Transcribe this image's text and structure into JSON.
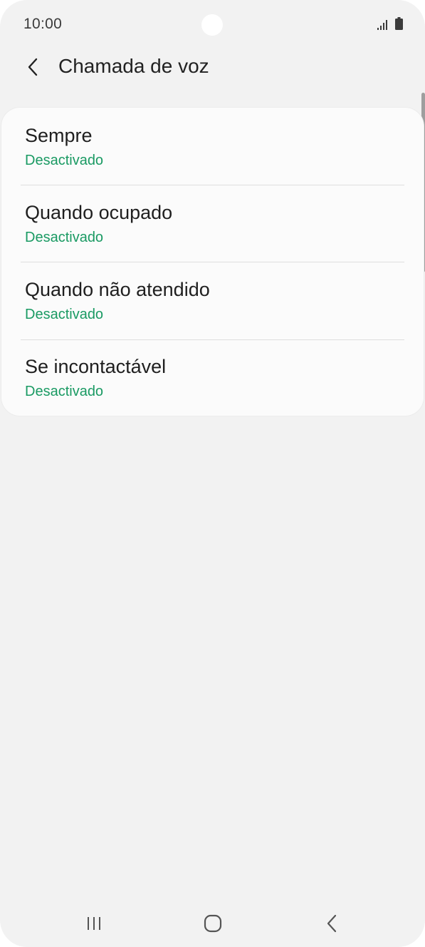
{
  "status_bar": {
    "time": "10:00",
    "icons": [
      "signal-icon",
      "battery-icon"
    ]
  },
  "header": {
    "back_icon": "chevron-left-icon",
    "title": "Chamada de voz"
  },
  "settings": {
    "items": [
      {
        "title": "Sempre",
        "status": "Desactivado"
      },
      {
        "title": "Quando ocupado",
        "status": "Desactivado"
      },
      {
        "title": "Quando não atendido",
        "status": "Desactivado"
      },
      {
        "title": "Se incontactável",
        "status": "Desactivado"
      }
    ]
  },
  "nav_bar": {
    "buttons": [
      "recents-icon",
      "home-icon",
      "back-icon"
    ]
  },
  "colors": {
    "background": "#f2f2f2",
    "card": "#fbfbfb",
    "status_text": "#1a9a63",
    "title_text": "#222222"
  }
}
